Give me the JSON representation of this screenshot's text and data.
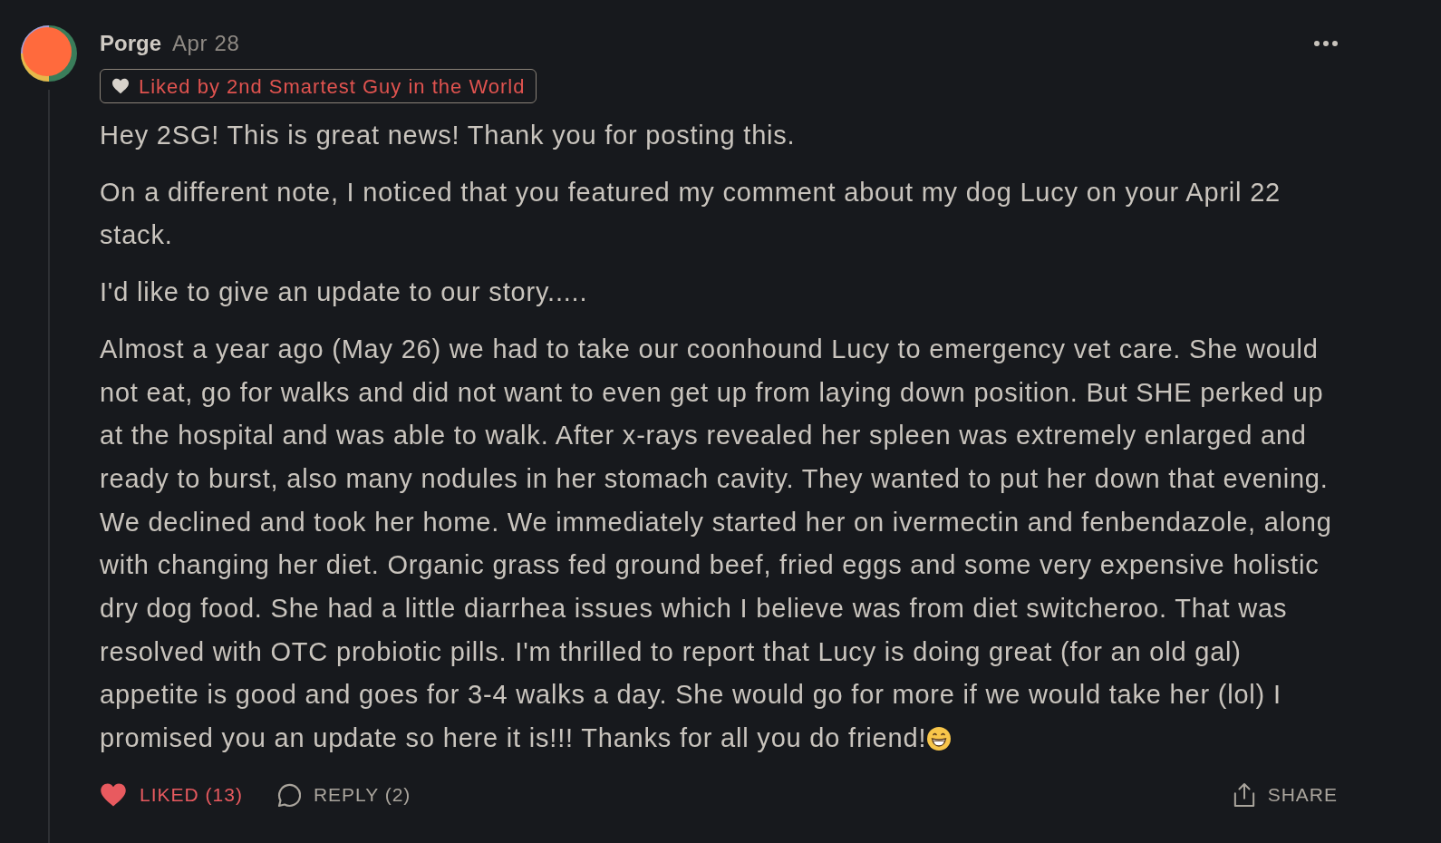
{
  "comment": {
    "author": "Porge",
    "date": "Apr 28",
    "liked_by_badge": "Liked by 2nd Smartest Guy in the World",
    "paragraphs": [
      "Hey 2SG! This is great news! Thank you for posting this.",
      "On a different note, I noticed that you featured my comment about my dog Lucy on your April 22 stack.",
      "I'd like to give an update to our story.....",
      "Almost a year ago (May 26) we had to take our coonhound Lucy to emergency vet care. She would not eat, go for walks and did not want to even get up from laying down position. But SHE perked up at the hospital and was able to walk. After x-rays revealed her spleen was extremely enlarged and ready to burst, also many nodules in her stomach cavity. They wanted to put her down that evening. We declined and took her home. We immediately started her on ivermectin and fenbendazole, along with changing her diet. Organic grass fed ground beef, fried eggs and some very expensive holistic dry dog food. She had a little diarrhea issues which I believe was from diet switcheroo. That was resolved with OTC probiotic pills. I'm thrilled to report that Lucy is doing great (for an old gal) appetite is good and goes for 3-4 walks a day. She would go for more if we would take her (lol) I promised you an update so here it is!!! Thanks for all you do friend!"
    ],
    "trailing_emoji": true
  },
  "actions": [
    {
      "kind": "like",
      "label": "LIKED (13)",
      "liked": true
    },
    {
      "kind": "reply",
      "label": "REPLY (2)"
    },
    {
      "kind": "share",
      "label": "SHARE"
    }
  ]
}
